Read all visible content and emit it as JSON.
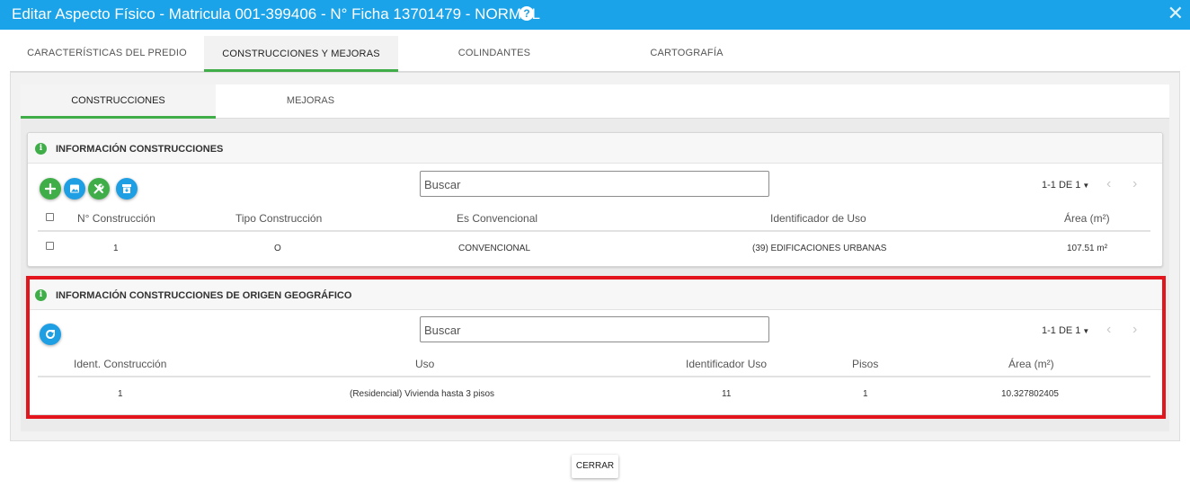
{
  "dialog": {
    "title": "Editar Aspecto Físico - Matricula 001-399406 - N° Ficha 13701479 - NORMAL",
    "help_symbol": "?",
    "close_symbol": "✕"
  },
  "main_tabs": [
    {
      "label": "CARACTERÍSTICAS DEL PREDIO",
      "active": false
    },
    {
      "label": "CONSTRUCCIONES Y MEJORAS",
      "active": true
    },
    {
      "label": "COLINDANTES",
      "active": false
    },
    {
      "label": "CARTOGRAFÍA",
      "active": false
    }
  ],
  "sub_tabs": [
    {
      "label": "CONSTRUCCIONES",
      "active": true
    },
    {
      "label": "MEJORAS",
      "active": false
    }
  ],
  "construcciones": {
    "header": "INFORMACIÓN CONSTRUCCIONES",
    "search_placeholder": "Buscar",
    "pager": "1-1 DE 1",
    "toolbar_icons": [
      "add-icon",
      "image-icon",
      "tools-icon",
      "archive-icon"
    ],
    "columns": [
      "N° Construcción",
      "Tipo Construcción",
      "Es Convencional",
      "Identificador de Uso",
      "Área (m²)"
    ],
    "rows": [
      [
        "1",
        "O",
        "CONVENCIONAL",
        "(39) EDIFICACIONES URBANAS",
        "107.51 m²"
      ]
    ]
  },
  "geografico": {
    "header": "INFORMACIÓN CONSTRUCCIONES DE ORIGEN GEOGRÁFICO",
    "search_placeholder": "Buscar",
    "pager": "1-1 DE 1",
    "toolbar_icons": [
      "refresh-icon"
    ],
    "columns": [
      "Ident. Construcción",
      "Uso",
      "Identificador Uso",
      "Pisos",
      "Área (m²)"
    ],
    "rows": [
      [
        "1",
        "(Residencial) Vivienda hasta 3 pisos",
        "11",
        "1",
        "10.327802405"
      ]
    ]
  },
  "footer": {
    "close_label": "CERRAR"
  },
  "colors": {
    "title_bar": "#1aa3e8",
    "accent_green": "#3fae49",
    "accent_blue": "#1e9ee3",
    "highlight_red": "#e3141b"
  }
}
